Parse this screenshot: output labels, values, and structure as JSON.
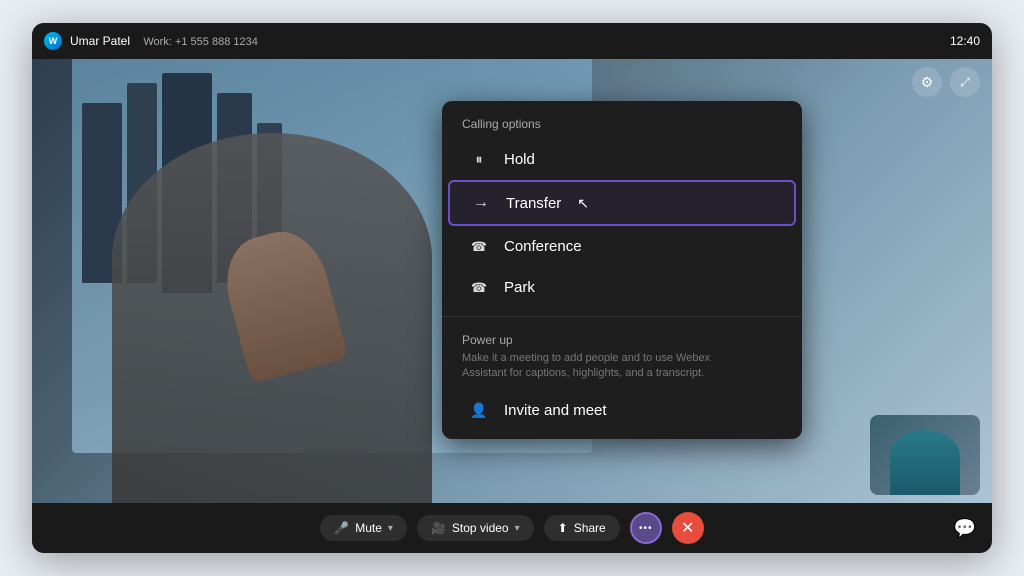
{
  "topbar": {
    "logo_label": "W",
    "caller_name": "Umar Patel",
    "caller_number": "Work: +1 555 888 1234",
    "time": "12:40"
  },
  "topbar_icons": {
    "settings_icon": "⚙",
    "expand_icon": "⤢"
  },
  "dropdown": {
    "section_title": "Calling options",
    "items": [
      {
        "id": "hold",
        "icon": "⏸",
        "label": "Hold",
        "active": false
      },
      {
        "id": "transfer",
        "icon": "→",
        "label": "Transfer",
        "active": true
      },
      {
        "id": "conference",
        "icon": "☎",
        "label": "Conference",
        "active": false
      },
      {
        "id": "park",
        "icon": "☎",
        "label": "Park",
        "active": false
      }
    ],
    "power_up": {
      "title": "Power up",
      "description": "Make it a meeting to add people and to use Webex\nAssistant for captions, highlights, and a transcript.",
      "item_icon": "👤",
      "item_label": "Invite and meet"
    }
  },
  "controls": {
    "mute_label": "Mute",
    "stop_video_label": "Stop video",
    "share_label": "Share",
    "more_icon": "•••",
    "end_icon": "✕"
  }
}
